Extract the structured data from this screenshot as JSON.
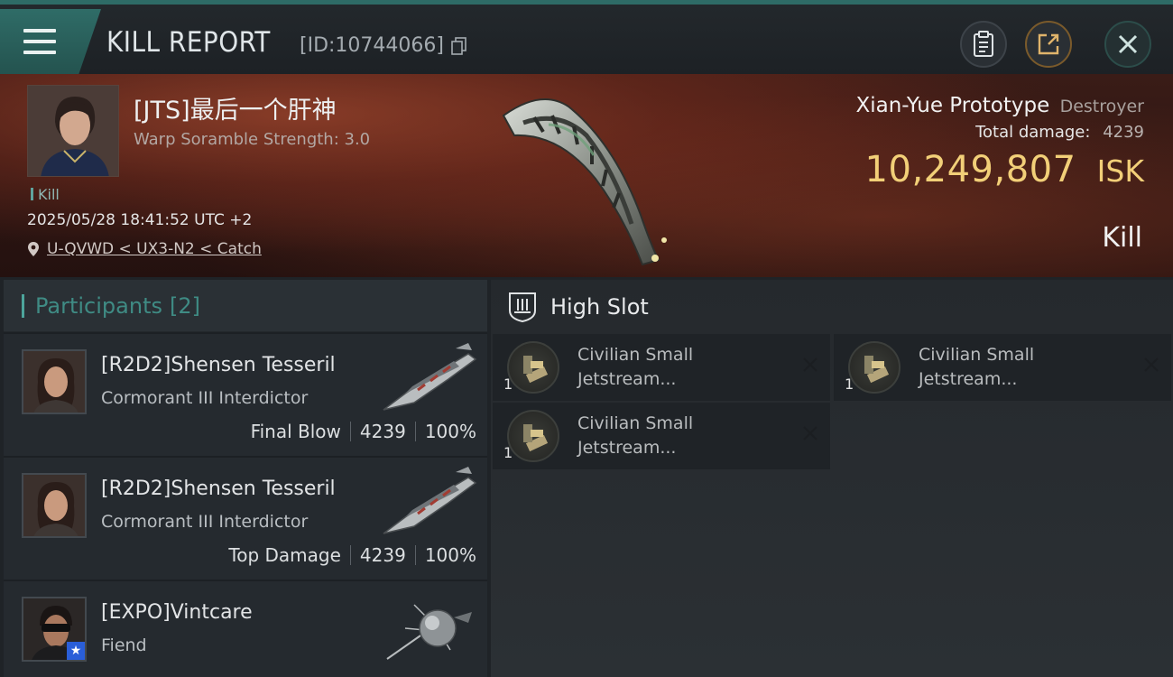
{
  "header": {
    "title": "KILL REPORT",
    "report_id": "[ID:10744066]"
  },
  "victim": {
    "name": "[JTS]最后一个肝神",
    "warp_scramble": "Warp Soramble Strength: 3.0",
    "tag": "Kill",
    "timestamp": "2025/05/28 18:41:52 UTC +2",
    "location": "U-QVWD < UX3-N2 < Catch",
    "ship_name": "Xian-Yue Prototype",
    "ship_class": "Destroyer",
    "total_damage_label": "Total damage:",
    "total_damage": "4239",
    "isk_value": "10,249,807",
    "isk_unit": "ISK",
    "status": "Kill"
  },
  "participants": {
    "label": "Participants",
    "count": "[2]",
    "rows": [
      {
        "name": "[R2D2]Shensen Tesseril",
        "ship": "Cormorant III Interdictor",
        "role": "Final Blow",
        "damage": "4239",
        "percent": "100%"
      },
      {
        "name": "[R2D2]Shensen Tesseril",
        "ship": "Cormorant III Interdictor",
        "role": "Top Damage",
        "damage": "4239",
        "percent": "100%"
      },
      {
        "name": "[EXPO]Vintcare",
        "ship": "Fiend"
      }
    ]
  },
  "high_slot": {
    "label": "High Slot",
    "modules": [
      {
        "line1": "Civilian Small",
        "line2": "Jetstream...",
        "qty": "1"
      },
      {
        "line1": "Civilian Small",
        "line2": "Jetstream...",
        "qty": "1"
      },
      {
        "line1": "Civilian Small",
        "line2": "Jetstream...",
        "qty": "1"
      }
    ]
  },
  "colors": {
    "accent_teal": "#2e6b66",
    "isk_gold": "#f2cf78",
    "badge_blue": "#2a5ed8"
  },
  "icons": [
    "menu-icon",
    "copy-icon",
    "clipboard-icon",
    "share-icon",
    "close-icon",
    "location-pin-icon",
    "high-slot-icon",
    "remove-icon",
    "star-icon"
  ]
}
